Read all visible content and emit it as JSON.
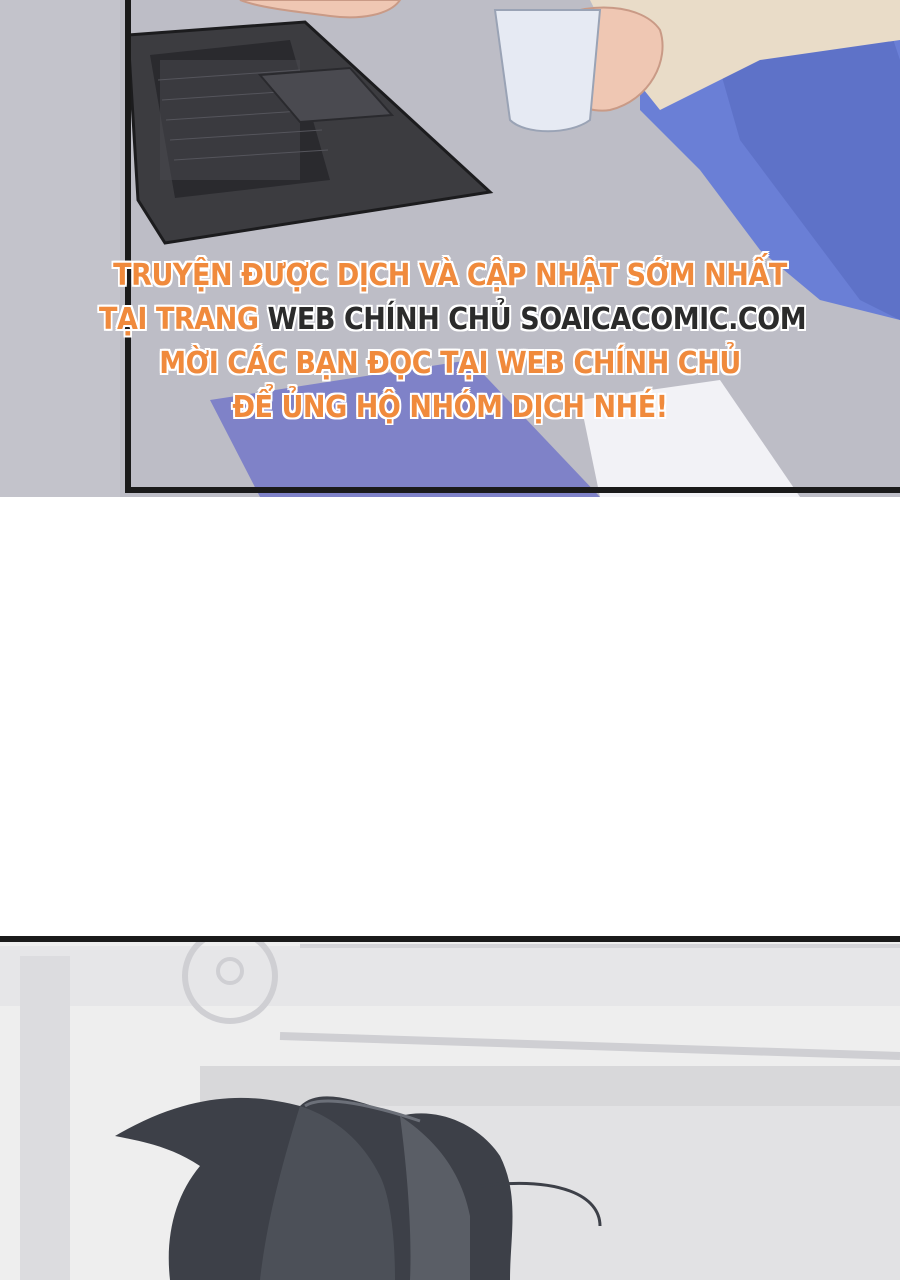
{
  "watermark": {
    "line1": "TRUYỆN ĐƯỢC DỊCH VÀ CẬP NHẬT SỚM NHẤT",
    "line2_part1": "TẠI TRANG",
    "line2_part2": "WEB CHÍNH CHỦ SOAICACOMIC.COM",
    "line3": "MỜI CÁC BẠN ĐỌC TẠI WEB CHÍNH CHỦ",
    "line4": "ĐỂ ỦNG HỘ NHÓM DỊCH NHÉ!"
  },
  "colors": {
    "watermark_orange": "#f08a3c",
    "watermark_dark": "#2b2b2b",
    "panel_border": "#1a1a1a",
    "table_surface": "#b9b9c3",
    "laptop": "#3c3c40",
    "dress_blue": "#6a7fd6",
    "hair": "#3d4048"
  }
}
